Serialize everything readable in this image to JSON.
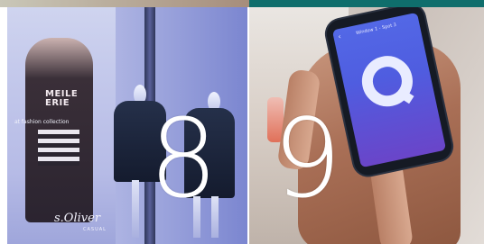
{
  "left_panel": {
    "poster_headline": "MEILE ERIE",
    "poster_tagline": "at fashion collection",
    "brand_logo": "s.Oliver",
    "brand_sub": "CASUAL",
    "number": "8"
  },
  "right_panel": {
    "screen_title": "Window 1 - Spot 3",
    "number": "9"
  },
  "colors": {
    "top_strip": "#0f6e6c",
    "screen_gradient_start": "#5368e6",
    "screen_gradient_end": "#6a45c9"
  }
}
